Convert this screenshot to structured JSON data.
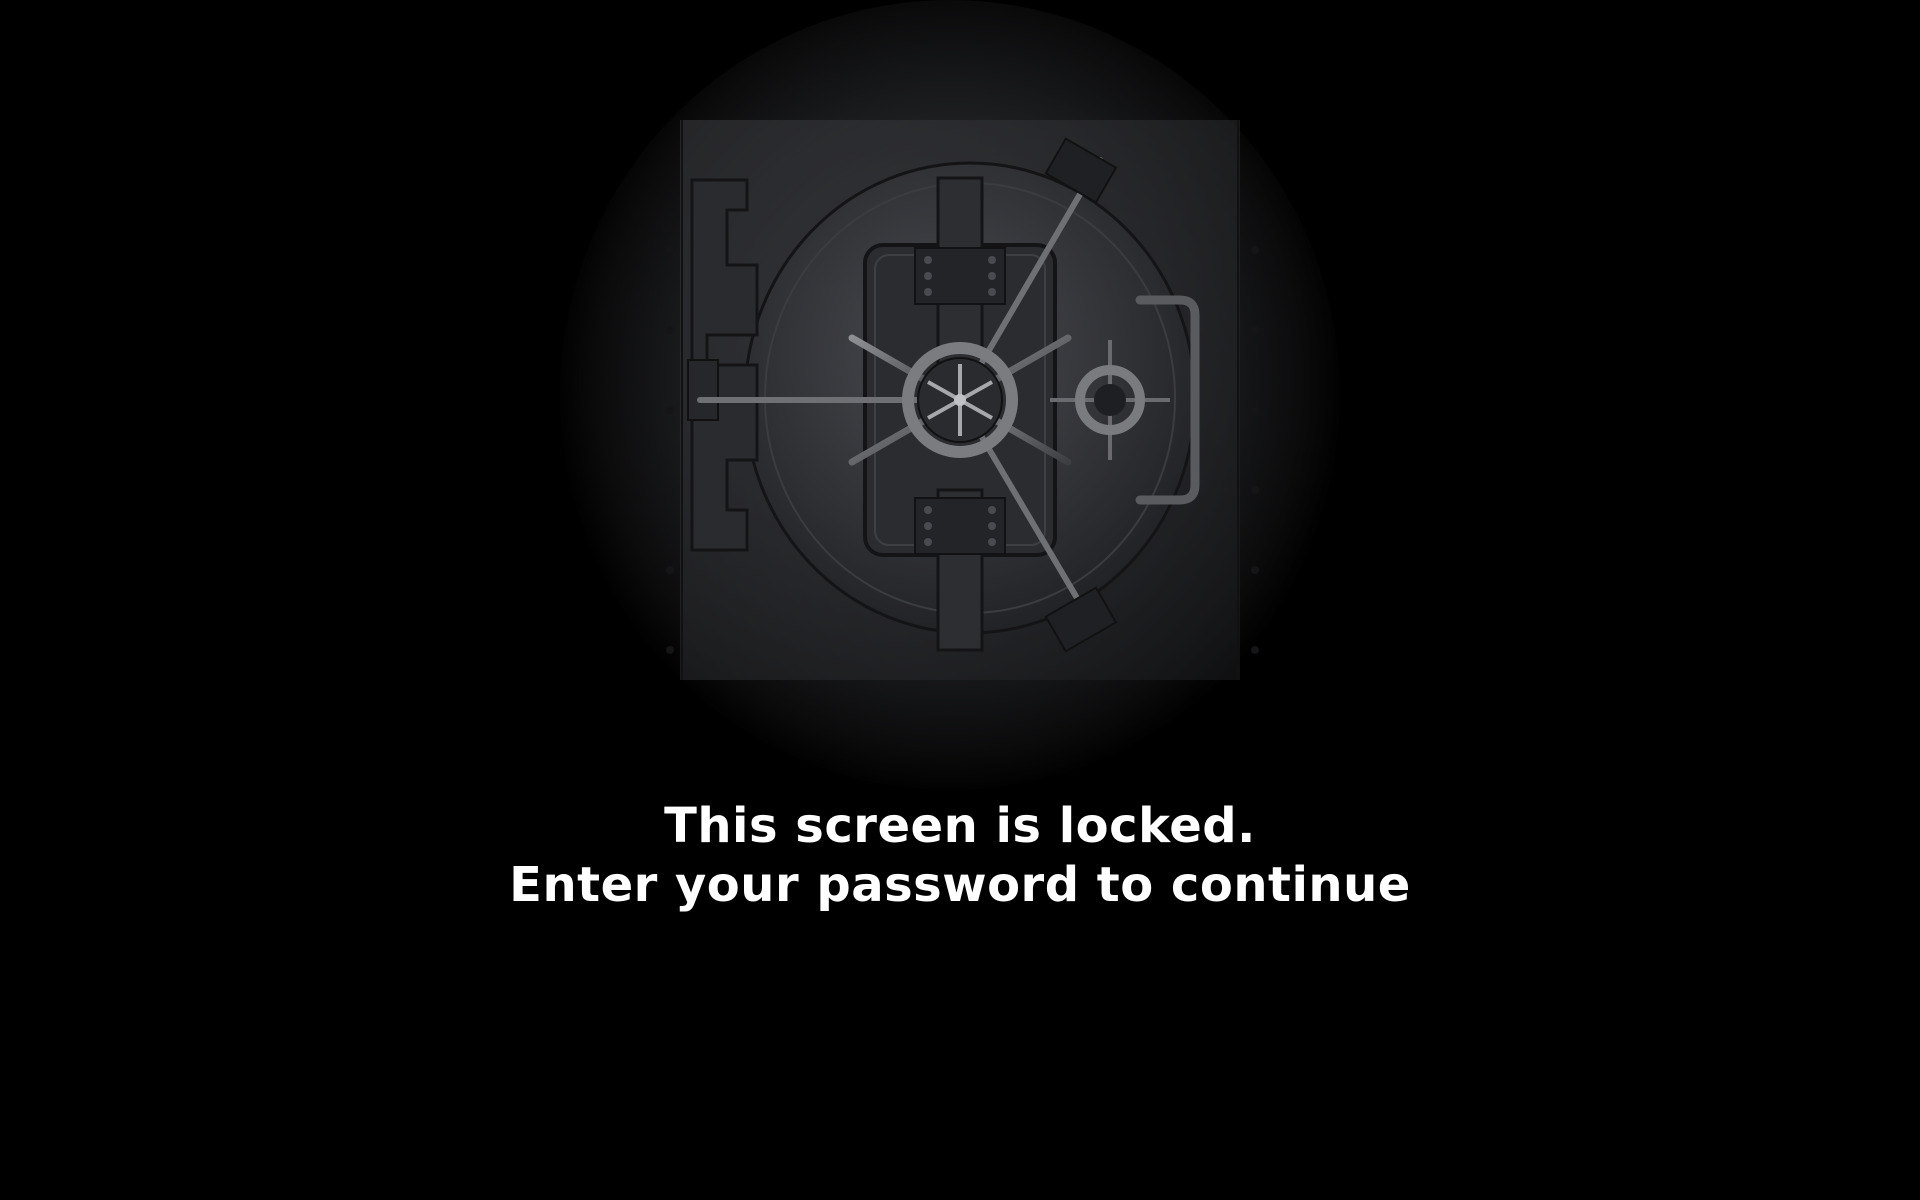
{
  "lock_screen": {
    "message_line1": "This screen is locked.",
    "message_line2": "Enter your password to continue",
    "background_color": "#000000",
    "text_color": "#ffffff",
    "illustration": "bank-vault-door-icon"
  }
}
